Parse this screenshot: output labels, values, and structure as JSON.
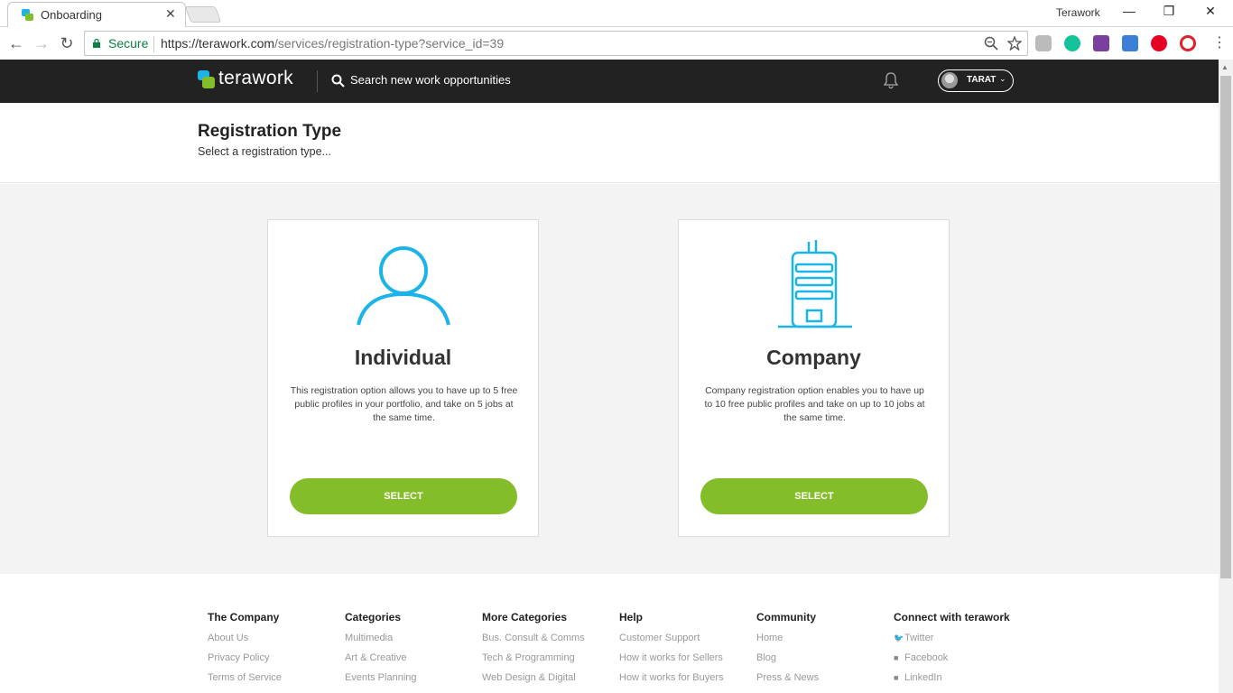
{
  "browser": {
    "tab_title": "Onboarding",
    "tab_close": "✕",
    "window_title": "Terawork",
    "secure_label": "Secure",
    "url_host": "https://terawork.com",
    "url_path": "/services/registration-type?service_id=39"
  },
  "header": {
    "logo_text": "terawork",
    "search_placeholder": "Search new work opportunities",
    "user_name": "TARAT",
    "colors": {
      "bar": "#222222",
      "logo_green": "#84bd2a",
      "logo_blue": "#1ab4e8"
    }
  },
  "page": {
    "title": "Registration Type",
    "subtitle": "Select a registration type..."
  },
  "cards": [
    {
      "icon": "person-icon",
      "title": "Individual",
      "description": "This registration option allows you to have up to 5 free public profiles in your portfolio, and take on 5 jobs at the same time.",
      "button": "SELECT"
    },
    {
      "icon": "building-icon",
      "title": "Company",
      "description": "Company registration option enables you to have up to 10 free public profiles and take on up to 10 jobs at the same time.",
      "button": "SELECT"
    }
  ],
  "accent": {
    "button_green": "#84bd2a",
    "icon_blue": "#1ab4e8"
  },
  "footer": {
    "columns": [
      {
        "heading": "The Company",
        "links": [
          "About Us",
          "Privacy Policy",
          "Terms of Service"
        ]
      },
      {
        "heading": "Categories",
        "links": [
          "Multimedia",
          "Art & Creative",
          "Events Planning"
        ]
      },
      {
        "heading": "More Categories",
        "links": [
          "Bus. Consult & Comms",
          "Tech & Programming",
          "Web Design & Digital"
        ]
      },
      {
        "heading": "Help",
        "links": [
          "Customer Support",
          "How it works for Sellers",
          "How it works for Buyers"
        ]
      },
      {
        "heading": "Community",
        "links": [
          "Home",
          "Blog",
          "Press & News"
        ]
      },
      {
        "heading": "Connect with terawork",
        "links": [
          "Twitter",
          "Facebook",
          "LinkedIn"
        ]
      }
    ]
  }
}
